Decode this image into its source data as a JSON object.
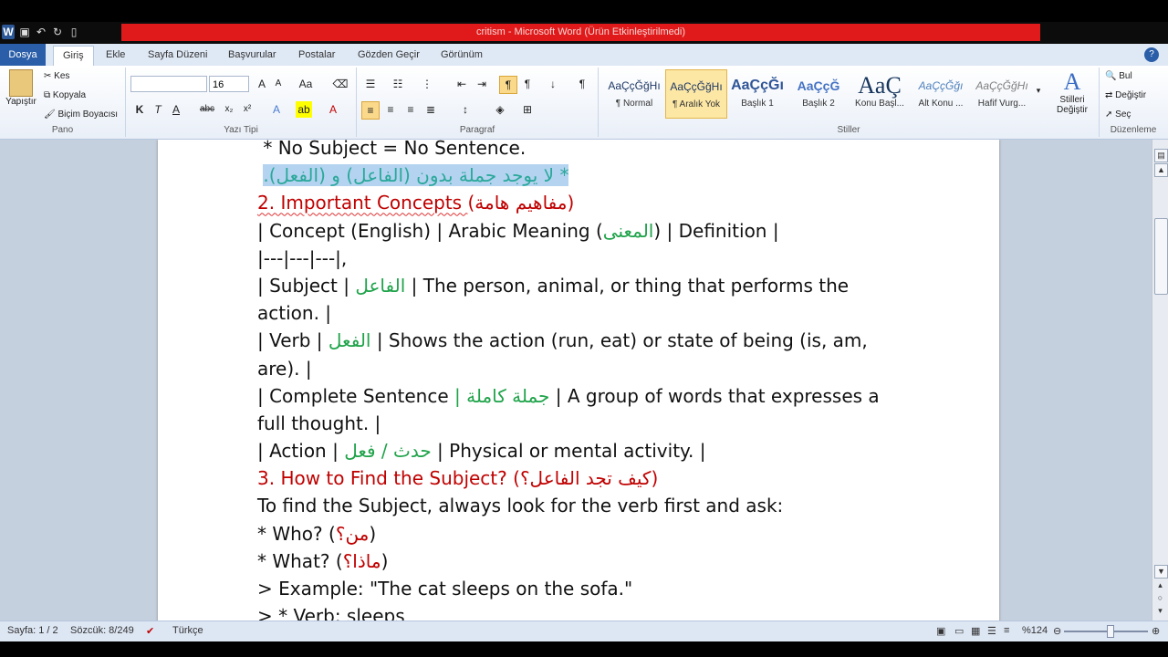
{
  "window": {
    "title": "critism - Microsoft Word (Ürün Etkinleştirilmedi)"
  },
  "ribbon_tabs": [
    "Dosya",
    "Giriş",
    "Ekle",
    "Sayfa Düzeni",
    "Başvurular",
    "Postalar",
    "Gözden Geçir",
    "Görünüm"
  ],
  "clipboard": {
    "paste": "Yapıştır",
    "cut": "Kes",
    "copy": "Kopyala",
    "format_painter": "Biçim Boyacısı",
    "label": "Pano"
  },
  "font": {
    "name": "",
    "size": "16",
    "label": "Yazı Tipi"
  },
  "paragraph": {
    "label": "Paragraf"
  },
  "styles": {
    "items": [
      {
        "preview": "AaÇçĞğHı",
        "name": "¶ Normal"
      },
      {
        "preview": "AaÇçĞğHı",
        "name": "¶ Aralık Yok"
      },
      {
        "preview": "AaÇçĞı",
        "name": "Başlık 1"
      },
      {
        "preview": "AaÇçĞ",
        "name": "Başlık 2"
      },
      {
        "preview": "AaÇ",
        "name": "Konu Başl..."
      },
      {
        "preview": "AaÇçĞğı",
        "name": "Alt Konu ..."
      },
      {
        "preview": "AaÇçĞğHı",
        "name": "Hafif Vurg..."
      }
    ],
    "change_styles": "Stilleri Değiştir",
    "label": "Stiller"
  },
  "editing": {
    "find": "Bul",
    "replace": "Değiştir",
    "select": "Seç",
    "label": "Düzenleme"
  },
  "doc": {
    "l1": "* No Subject = No Sentence.",
    "l2": "* لا يوجد جملة بدون (الفاعل) و (الفعل).",
    "l3_en": "2. Important Concepts ",
    "l3_ar": "(مفاهيم هامة)",
    "l4a": "| Concept (English) | Arabic Meaning (",
    "l4b": "المعنى",
    "l4c": ") | Definition |",
    "l5": "|---|---|---|,",
    "l6a": "| Subject | ",
    "l6b": "الفاعل",
    "l6c": " | The person, animal, or thing that performs the",
    "l7": "action. |",
    "l8a": "| Verb | ",
    "l8b": "الفعل",
    "l8c": " | Shows the action (run, eat) or state of being (is, am,",
    "l9": "are). |",
    "l10a": "| Complete Sentence ",
    "l10b": "| جملة كاملة",
    "l10c": " | A group of words that expresses a",
    "l11": "full thought. |",
    "l12a": "| Action | ",
    "l12b": "حدث / فعل",
    "l12c": " | Physical or mental activity. |",
    "l13_en": "3. How to Find the Subject? ",
    "l13_ar": "(كيف تجد الفاعل؟)",
    "l14": "To find the Subject, always look for the verb first and ask:",
    "l15a": " * Who? (",
    "l15b": "من؟",
    "l15c": ")",
    "l16a": " * What? (",
    "l16b": "ماذا؟",
    "l16c": ")",
    "l17": "> Example: \"The cat sleeps on the sofa.\"",
    "l18": ">  * Verb: sleeps"
  },
  "status": {
    "page": "Sayfa: 1 / 2",
    "words": "Sözcük: 8/249",
    "language": "Türkçe",
    "zoom": "%124"
  }
}
